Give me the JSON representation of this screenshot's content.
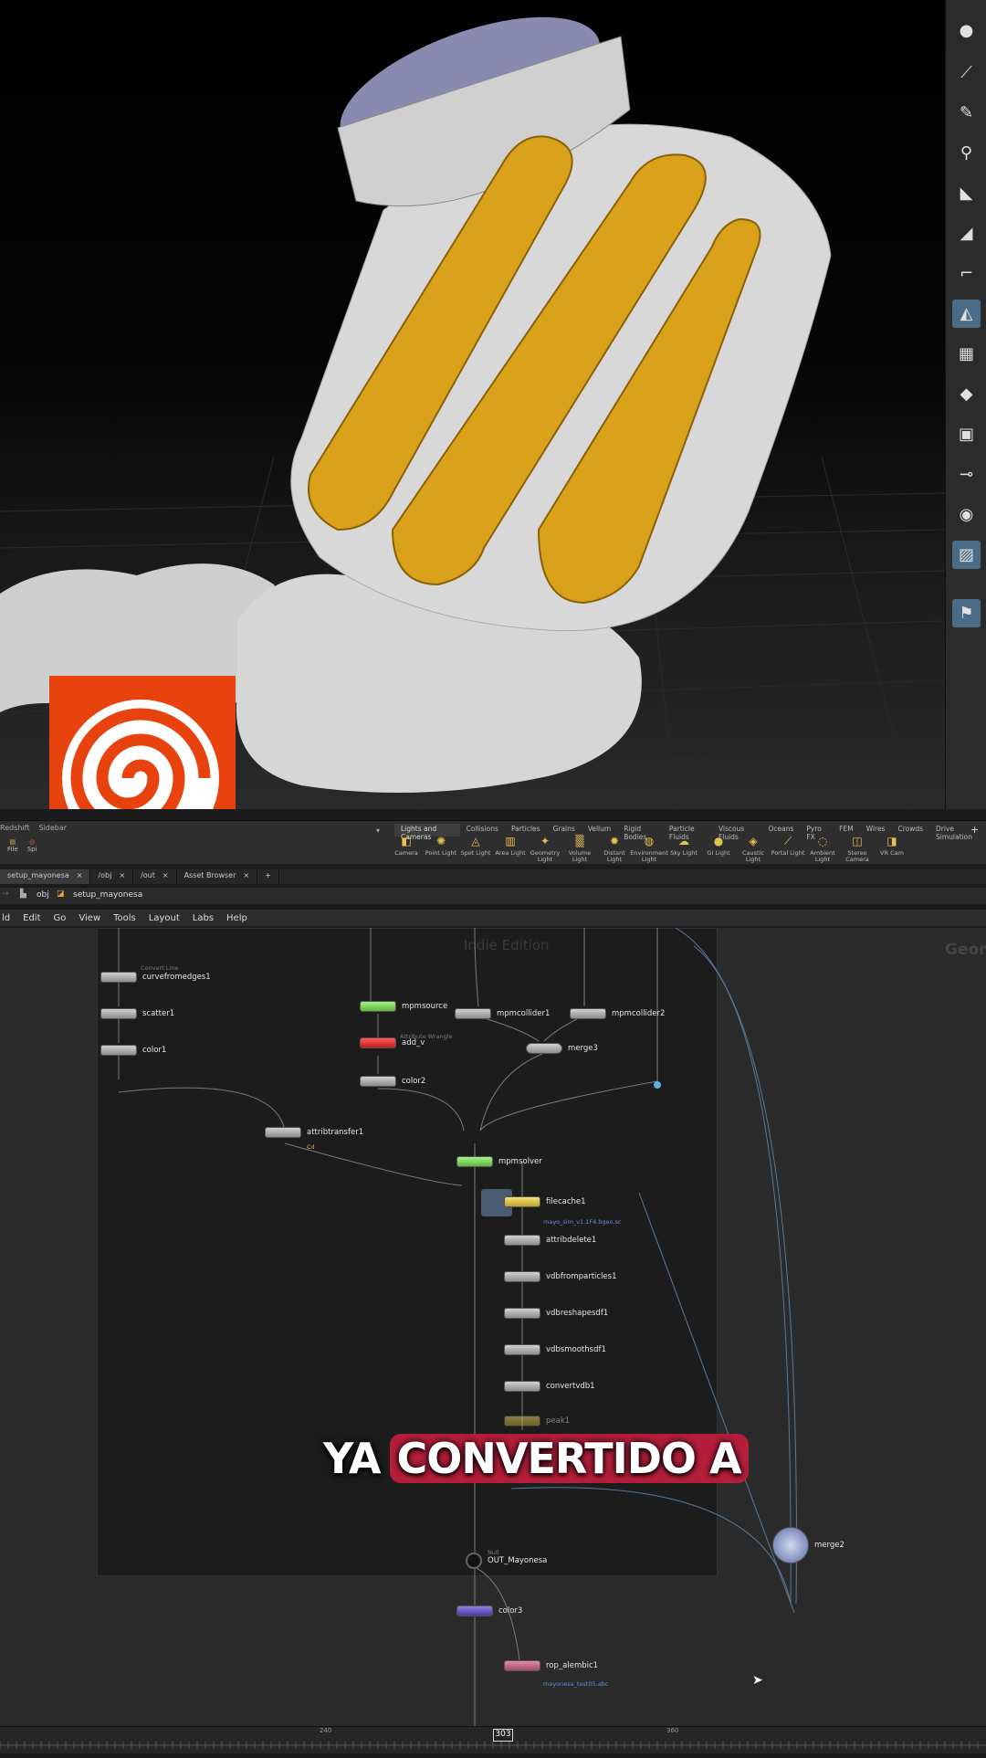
{
  "shelf": {
    "left_tabs": [
      "Redshift",
      "Sidebar"
    ],
    "left_tools": [
      "File",
      "Spi"
    ],
    "tabs": [
      "Lights and Cameras",
      "Collisions",
      "Particles",
      "Grains",
      "Vellum",
      "Rigid Bodies",
      "Particle Fluids",
      "Viscous Fluids",
      "Oceans",
      "Pyro FX",
      "FEM",
      "Wires",
      "Crowds",
      "Drive Simulation"
    ],
    "tools": [
      "Camera",
      "Point Light",
      "Spot Light",
      "Area Light",
      "Geometry Light",
      "Volume Light",
      "Distant Light",
      "Environment Light",
      "Sky Light",
      "GI Light",
      "Caustic Light",
      "Portal Light",
      "Ambient Light",
      "Stereo Camera",
      "VR Cam"
    ]
  },
  "pane_tabs": [
    "setup_mayonesa",
    "/obj",
    "/out",
    "Asset Browser"
  ],
  "path": {
    "level": "obj",
    "node": "setup_mayonesa"
  },
  "menu": [
    "ld",
    "Edit",
    "Go",
    "View",
    "Tools",
    "Layout",
    "Labs",
    "Help"
  ],
  "network": {
    "watermark": "Indie Edition",
    "context_label": "Geon",
    "nodes": {
      "curvefromedges1": {
        "label": "curvefromedges1",
        "type": "Convert Line"
      },
      "scatter1": {
        "label": "scatter1"
      },
      "color1": {
        "label": "color1"
      },
      "mpmsource": {
        "label": "mpmsource"
      },
      "add_v": {
        "label": "add_v",
        "type": "Attribute Wrangle"
      },
      "color2": {
        "label": "color2"
      },
      "attribtransfer1": {
        "label": "attribtransfer1",
        "sub": "Cd"
      },
      "mpmcollider1": {
        "label": "mpmcollider1"
      },
      "mpmcollider2": {
        "label": "mpmcollider2"
      },
      "merge3": {
        "label": "merge3"
      },
      "mpmsolver": {
        "label": "mpmsolver"
      },
      "filecache1": {
        "label": "filecache1",
        "sub": "mayo_sim_v1.1F4.bgeo.sc"
      },
      "attribdelete1": {
        "label": "attribdelete1"
      },
      "vdbfromparticles1": {
        "label": "vdbfromparticles1"
      },
      "vdbreshapesdf1": {
        "label": "vdbreshapesdf1"
      },
      "vdbsmoothsdf1": {
        "label": "vdbsmoothsdf1"
      },
      "convertvdb1": {
        "label": "convertvdb1"
      },
      "peak1": {
        "label": "peak1"
      },
      "out_mayonesa": {
        "label": "OUT_Mayonesa",
        "type": "Null"
      },
      "merge2": {
        "label": "merge2"
      },
      "color3": {
        "label": "color3"
      },
      "rop_alembic1": {
        "label": "rop_alembic1",
        "sub": "mayonesa_test05.abc"
      }
    }
  },
  "caption": {
    "before": "YA",
    "highlight": "CONVERTIDO A"
  },
  "timeline": {
    "current_frame": "303",
    "ticks": [
      "240",
      "360"
    ]
  },
  "colors": {
    "accent": "#b41e3a",
    "logo": "#e8420e",
    "mayo": "#d9a21a"
  }
}
